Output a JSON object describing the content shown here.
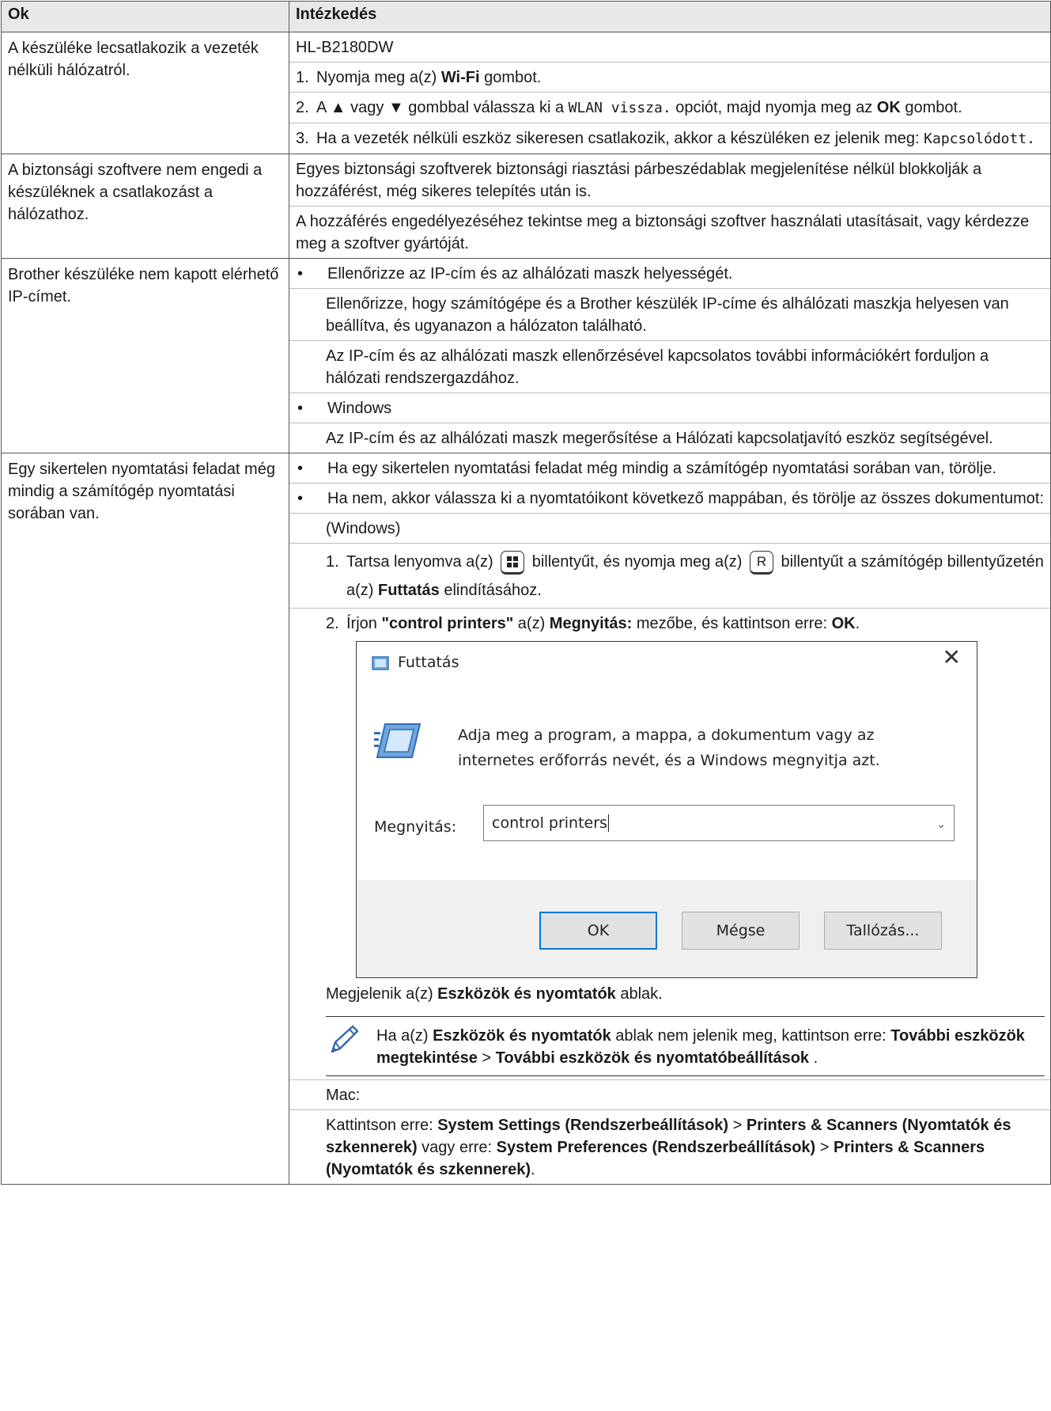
{
  "header": {
    "col1": "Ok",
    "col2": "Intézkedés"
  },
  "row1": {
    "cause": "A készüléke lecsatlakozik a vezeték nélküli hálózatról.",
    "model": "HL-B2180DW",
    "step1": {
      "n": "1.",
      "a": "Nyomja meg a(z) ",
      "b": "Wi-Fi",
      "c": " gombot."
    },
    "step2": {
      "n": "2.",
      "a": "A ▲ vagy ▼ gombbal válassza ki a ",
      "code": "WLAN vissza.",
      "b": " opciót, majd nyomja meg az ",
      "bold": "OK",
      "c": " gombot."
    },
    "step3": {
      "n": "3.",
      "a": "Ha a vezeték nélküli eszköz sikeresen csatlakozik, akkor a készüléken ez jelenik meg: ",
      "code": "Kapcsolódott."
    }
  },
  "row2": {
    "cause": "A biztonsági szoftvere nem engedi a készüléknek a csatlakozást a hálózathoz.",
    "p1": "Egyes biztonsági szoftverek biztonsági riasztási párbeszédablak megjelenítése nélkül blokkolják a hozzáférést, még sikeres telepítés után is.",
    "p2": "A hozzáférés engedélyezéséhez tekintse meg a biztonsági szoftver használati utasításait, vagy kérdezze meg a szoftver gyártóját."
  },
  "row3": {
    "cause": "Brother készüléke nem kapott elérhető IP-címet.",
    "b1": "Ellenőrizze az IP-cím és az alhálózati maszk helyességét.",
    "b1p1": "Ellenőrizze, hogy számítógépe és a Brother készülék IP-címe és alhálózati maszkja helyesen van beállítva, és ugyanazon a hálózaton található.",
    "b1p2": "Az IP-cím és az alhálózati maszk ellenőrzésével kapcsolatos további információkért forduljon a hálózati rendszergazdához.",
    "b2": "Windows",
    "b2p1": "Az IP-cím és az alhálózati maszk megerősítése a Hálózati kapcsolatjavító eszköz segítségével."
  },
  "row4": {
    "cause": "Egy sikertelen nyomtatási feladat még mindig a számítógép nyomtatási sorában van.",
    "b1": "Ha egy sikertelen nyomtatási feladat még mindig a számítógép nyomtatási sorában van, törölje.",
    "b2": "Ha nem, akkor válassza ki a nyomtatóikont következő mappában, és törölje az összes dokumentumot:",
    "windows_label": "(Windows)",
    "s1": {
      "n": "1.",
      "a": "Tartsa lenyomva a(z) ",
      "b": " billentyűt, és nyomja meg a(z) ",
      "key": "R",
      "c": " billentyűt a számítógép billentyűzetén a(z) ",
      "bold": "Futtatás",
      "d": " elindításához."
    },
    "s2": {
      "n": "2.",
      "a": "Írjon ",
      "bold1": "\"control printers\"",
      "b": " a(z) ",
      "bold2": "Megnyitás:",
      "c": " mezőbe, és kattintson erre: ",
      "bold3": "OK",
      "d": "."
    },
    "dialog": {
      "title": "Futtatás",
      "description": "Adja meg a program, a mappa, a dokumentum vagy az internetes erőforrás nevét, és a Windows megnyitja azt.",
      "open_label": "Megnyitás:",
      "open_value": "control printers",
      "ok": "OK",
      "cancel": "Mégse",
      "browse": "Tallózás..."
    },
    "after": {
      "a": "Megjelenik a(z) ",
      "bold": "Eszközök és nyomtatók",
      "b": " ablak."
    },
    "note": {
      "a": "Ha a(z) ",
      "bold1": "Eszközök és nyomtatók",
      "b": " ablak nem jelenik meg, kattintson erre: ",
      "bold2": "További eszközök megtekintése",
      "c": " > ",
      "bold3": "További eszközök és nyomtatóbeállítások",
      "d": " ."
    },
    "mac_label": "Mac:",
    "mac": {
      "a": "Kattintson erre: ",
      "bold1": "System Settings (Rendszerbeállítások)",
      "b": " > ",
      "bold2": "Printers & Scanners (Nyomtatók és szkennerek)",
      "c": " vagy erre: ",
      "bold3": "System Preferences (Rendszerbeállítások)",
      "d": " > ",
      "bold4": "Printers & Scanners (Nyomtatók és szkennerek)",
      "e": "."
    }
  },
  "icons": {
    "windows_key": "windows-logo-icon",
    "note": "pencil-icon",
    "run": "run-dialog-icon"
  }
}
